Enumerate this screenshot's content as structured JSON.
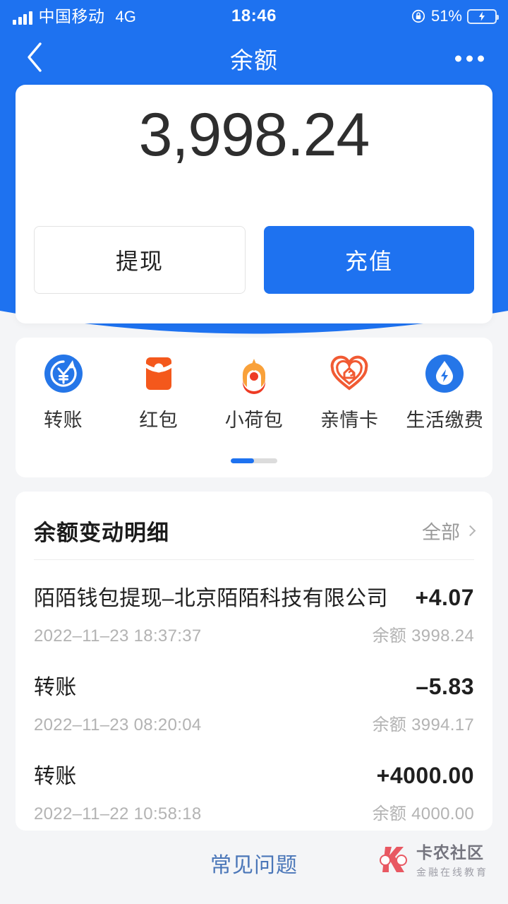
{
  "status_bar": {
    "carrier": "中国移动",
    "network": "4G",
    "time": "18:46",
    "battery_percent": "51%",
    "rotation_lock_icon": "rotation-lock-icon",
    "battery_icon": "battery-charging-icon",
    "signal_icon": "signal-bars-icon"
  },
  "navbar": {
    "back_icon": "chevron-left-icon",
    "title": "余额",
    "more_icon": "more-dots-icon"
  },
  "balance": {
    "amount": "3,998.24",
    "withdraw_label": "提现",
    "recharge_label": "充值"
  },
  "quick_actions": {
    "items": [
      {
        "label": "转账",
        "icon": "transfer-yuan-icon"
      },
      {
        "label": "红包",
        "icon": "red-packet-icon"
      },
      {
        "label": "小荷包",
        "icon": "small-purse-icon"
      },
      {
        "label": "亲情卡",
        "icon": "family-card-heart-icon"
      },
      {
        "label": "生活缴费",
        "icon": "utility-payment-icon"
      }
    ],
    "pager_active_index": 0,
    "pager_count": 2
  },
  "transactions": {
    "title": "余额变动明细",
    "all_label": "全部",
    "all_chevron_icon": "chevron-right-icon",
    "balance_prefix": "余额",
    "rows": [
      {
        "name": "陌陌钱包提现–北京陌陌科技有限公司",
        "amount": "+4.07",
        "date": "2022–11–23 18:37:37",
        "balance_after": "余额 3998.24"
      },
      {
        "name": "转账",
        "amount": "–5.83",
        "date": "2022–11–23 08:20:04",
        "balance_after": "余额 3994.17"
      },
      {
        "name": "转账",
        "amount": "+4000.00",
        "date": "2022–11–22 10:58:18",
        "balance_after": "余额 4000.00"
      }
    ]
  },
  "footer": {
    "faq_label": "常见问题",
    "watermark_main": "卡农社区",
    "watermark_sub": "金融在线教育",
    "watermark_icon": "kanong-logo-icon"
  },
  "colors": {
    "brand_blue": "#1E72F0",
    "page_bg": "#f4f5f7",
    "orange": "#F15A24",
    "link_blue": "#4a76b8",
    "battery_green": "#3ddc5c"
  }
}
